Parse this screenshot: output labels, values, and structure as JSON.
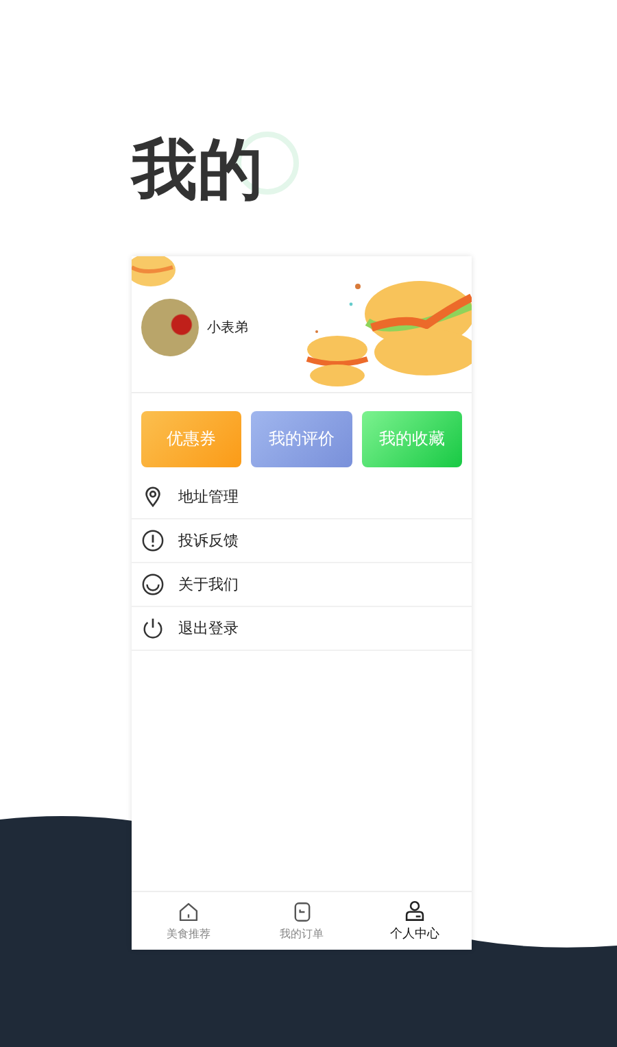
{
  "page_title": "我的",
  "profile": {
    "username": "小表弟"
  },
  "quick_buttons": [
    {
      "label": "优惠券",
      "kind": "orange"
    },
    {
      "label": "我的评价",
      "kind": "blue"
    },
    {
      "label": "我的收藏",
      "kind": "green"
    }
  ],
  "menu": [
    {
      "label": "地址管理",
      "kind": "location"
    },
    {
      "label": "投诉反馈",
      "kind": "alert"
    },
    {
      "label": "关于我们",
      "kind": "smile"
    },
    {
      "label": "退出登录",
      "kind": "power"
    }
  ],
  "tabs": [
    {
      "label": "美食推荐",
      "kind": "home",
      "selected": false
    },
    {
      "label": "我的订单",
      "kind": "order",
      "selected": false
    },
    {
      "label": "个人中心",
      "kind": "person",
      "selected": true
    }
  ]
}
